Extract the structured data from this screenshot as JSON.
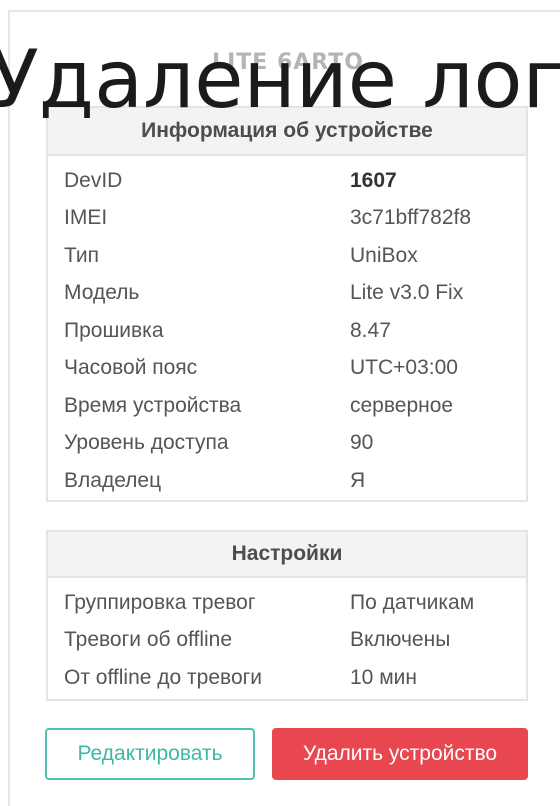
{
  "overlay_title": "Удаление логг",
  "device": {
    "name": "LITE 6ARTO"
  },
  "info_panel": {
    "title": "Информация об устройстве",
    "rows": [
      {
        "label": "DevID",
        "value": "1607"
      },
      {
        "label": "IMEI",
        "value": "3c71bff782f8"
      },
      {
        "label": "Тип",
        "value": "UniBox"
      },
      {
        "label": "Модель",
        "value": "Lite v3.0 Fix"
      },
      {
        "label": "Прошивка",
        "value": "8.47"
      },
      {
        "label": "Часовой пояс",
        "value": "UTC+03:00"
      },
      {
        "label": "Время устройства",
        "value": "серверное"
      },
      {
        "label": "Уровень доступа",
        "value": "90"
      },
      {
        "label": "Владелец",
        "value": "Я"
      }
    ]
  },
  "settings_panel": {
    "title": "Настройки",
    "rows": [
      {
        "label": "Группировка тревог",
        "value": "По датчикам"
      },
      {
        "label": "Тревоги об offline",
        "value": "Включены"
      },
      {
        "label": "От offline до тревоги",
        "value": "10 мин"
      }
    ]
  },
  "actions": {
    "edit_label": "Редактировать",
    "delete_label": "Удалить устройство"
  },
  "colors": {
    "edit_border": "#4fc3b0",
    "delete_bg": "#e8474f",
    "header_bg": "#f3f3f3"
  }
}
